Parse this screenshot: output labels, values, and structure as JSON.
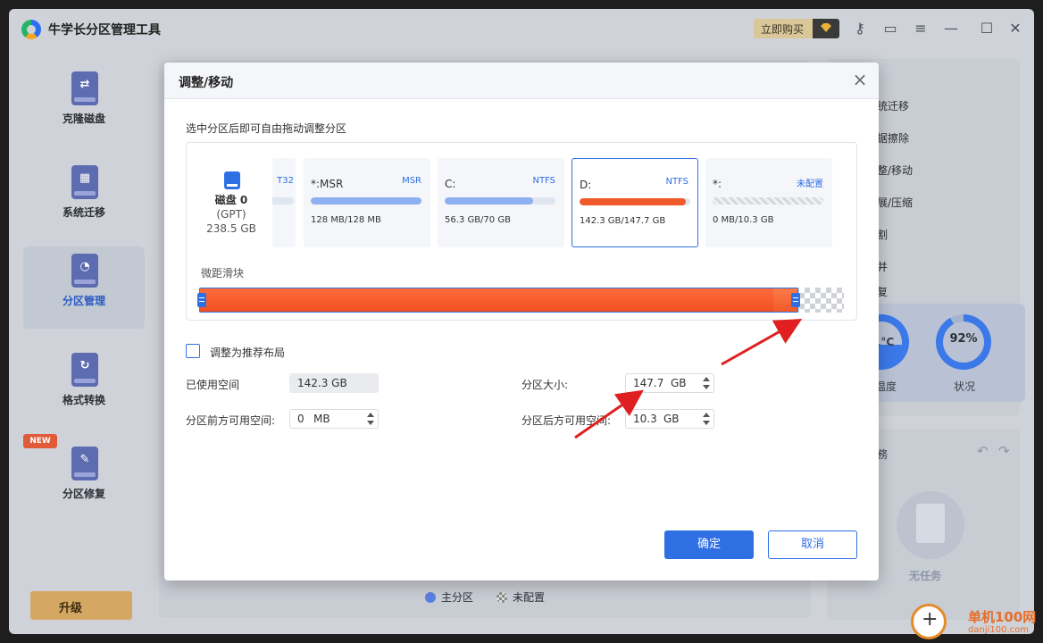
{
  "app": {
    "title": "牛学长分区管理工具",
    "buy_label": "立即购买"
  },
  "titlebar_icons": [
    "key-icon",
    "feedback-icon",
    "menu-icon",
    "minimize-icon",
    "maximize-icon",
    "close-icon"
  ],
  "sidebar": {
    "items": [
      {
        "label": "克隆磁盘",
        "icon": "clone-disk-icon",
        "glyph": "⇄"
      },
      {
        "label": "系统迁移",
        "icon": "system-migrate-icon",
        "glyph": "▦"
      },
      {
        "label": "分区管理",
        "icon": "partition-icon",
        "glyph": "◔",
        "active": true
      },
      {
        "label": "格式转换",
        "icon": "convert-icon",
        "glyph": "↻"
      },
      {
        "label": "分区修复",
        "icon": "repair-icon",
        "glyph": "✎",
        "badge": "NEW"
      }
    ],
    "upgrade_label": "升级"
  },
  "right_panel": {
    "items": [
      "统迁移",
      "据擦除",
      "整/移动",
      "展/压缩",
      "割",
      "并",
      "复"
    ],
    "temp_value": "1°C",
    "temp_label": "温度",
    "health_value": "92%",
    "health_label": "状况",
    "task_title": "務",
    "no_task": "无任务"
  },
  "legend": {
    "primary": "主分区",
    "unallocated": "未配置"
  },
  "dialog": {
    "title": "调整/移动",
    "hint": "选中分区后即可自由拖动调整分区",
    "disk": {
      "name": "磁盘 0",
      "type": "(GPT)",
      "size": "238.5 GB"
    },
    "partitions": [
      {
        "name": "",
        "fs": "T32",
        "size": "",
        "fill": 0.3
      },
      {
        "name": "*:MSR",
        "fs": "MSR",
        "size": "128 MB/128 MB",
        "fill": 1.0
      },
      {
        "name": "C:",
        "fs": "NTFS",
        "size": "56.3 GB/70 GB",
        "fill": 0.8
      },
      {
        "name": "D:",
        "fs": "NTFS",
        "size": "142.3 GB/147.7 GB",
        "fill": 0.96,
        "selected": true
      },
      {
        "name": "*:",
        "fs": "未配置",
        "size": "0 MB/10.3 GB",
        "fill": 0.0,
        "unallocated": true
      }
    ],
    "slider_label": "微距滑块",
    "slider": {
      "partition_fraction": 0.93,
      "used_fraction": 0.96
    },
    "recommend_label": "调整为推荐布局",
    "used_label": "已使用空间",
    "used_value": "142.3 GB",
    "size_label": "分区大小:",
    "size_value": "147.7",
    "size_unit": "GB",
    "before_label": "分区前方可用空间:",
    "before_value": "0",
    "before_unit": "MB",
    "after_label": "分区后方可用空间:",
    "after_value": "10.3",
    "after_unit": "GB",
    "ok_label": "确定",
    "cancel_label": "取消"
  },
  "watermark": {
    "text": "单机100网",
    "sub": "danji100.com"
  },
  "colors": {
    "accent": "#2f6fe4",
    "partition_fill": "#f05a2a",
    "arrow": "#e02020"
  }
}
